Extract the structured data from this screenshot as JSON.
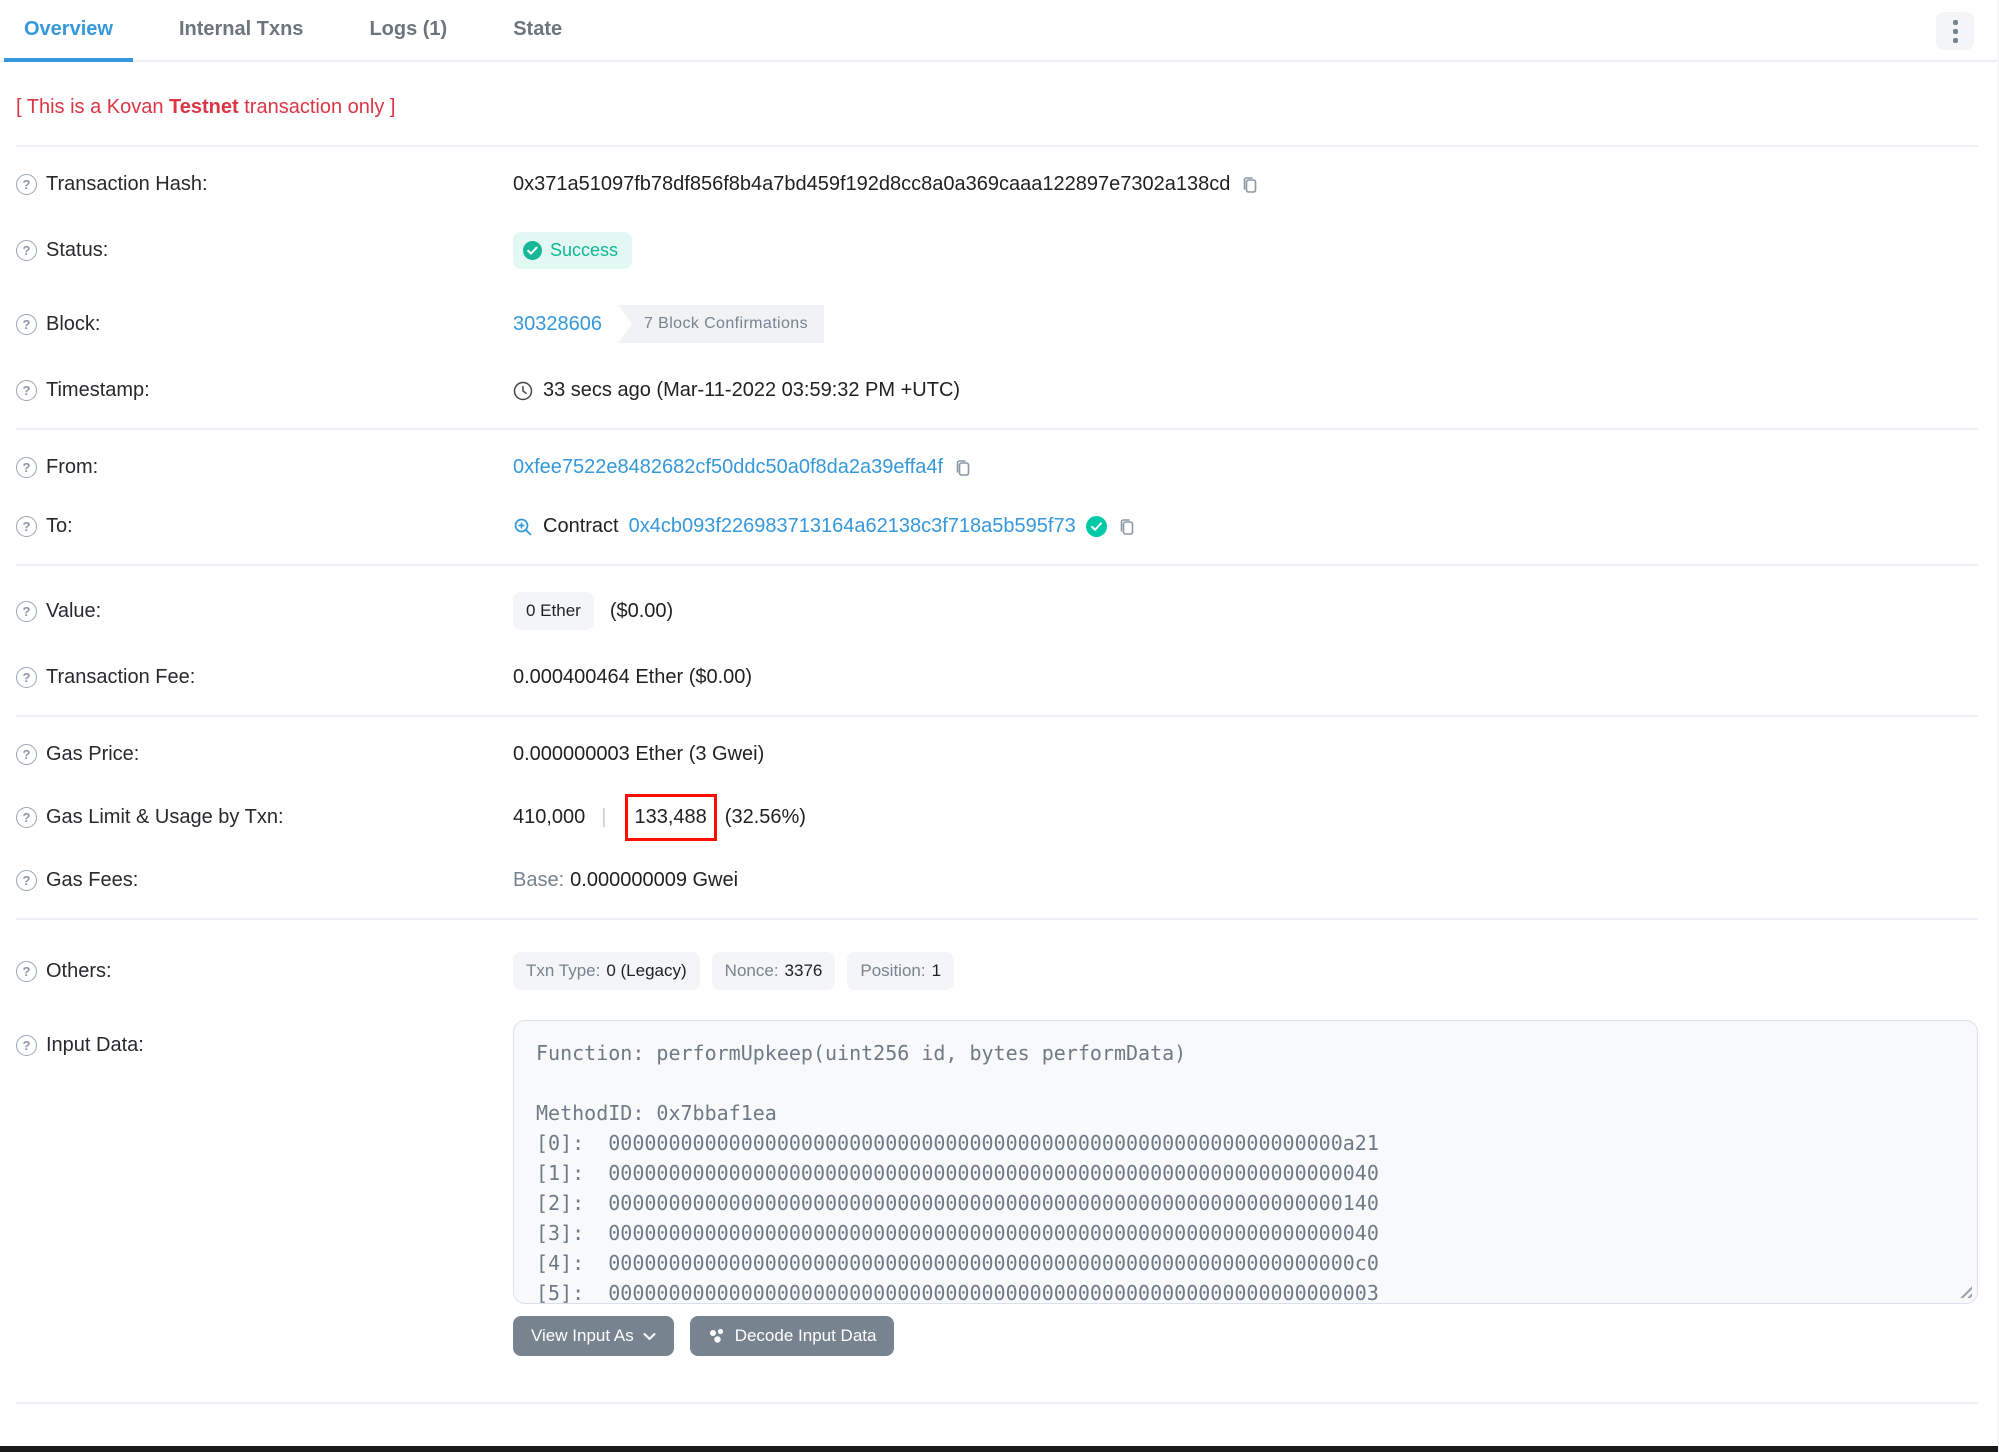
{
  "colors": {
    "accent_blue": "#3498db",
    "success_teal": "#00c9a7",
    "danger_red": "#dc3545",
    "slate": "#77838f"
  },
  "icons": {
    "help": "?"
  },
  "tabs": [
    {
      "label": "Overview",
      "active": true
    },
    {
      "label": "Internal Txns",
      "active": false
    },
    {
      "label": "Logs (1)",
      "active": false
    },
    {
      "label": "State",
      "active": false
    }
  ],
  "banner": {
    "prefix": "[ This is a Kovan ",
    "bold": "Testnet",
    "suffix": " transaction only ]"
  },
  "fields": {
    "tx_hash": {
      "label": "Transaction Hash:",
      "value": "0x371a51097fb78df856f8b4a7bd459f192d8cc8a0a369caaa122897e7302a138cd"
    },
    "status": {
      "label": "Status:",
      "value": "Success"
    },
    "block": {
      "label": "Block:",
      "number": "30328606",
      "confirmations": "7 Block Confirmations"
    },
    "timestamp": {
      "label": "Timestamp:",
      "value": "33 secs ago (Mar-11-2022 03:59:32 PM +UTC)"
    },
    "from": {
      "label": "From:",
      "address": "0xfee7522e8482682cf50ddc50a0f8da2a39effa4f"
    },
    "to": {
      "label": "To:",
      "prefix": "Contract",
      "address": "0x4cb093f226983713164a62138c3f718a5b595f73"
    },
    "value": {
      "label": "Value:",
      "badge": "0 Ether",
      "usd": "($0.00)"
    },
    "tx_fee": {
      "label": "Transaction Fee:",
      "value": "0.000400464 Ether ($0.00)"
    },
    "gas_price": {
      "label": "Gas Price:",
      "value": "0.000000003 Ether (3 Gwei)"
    },
    "gas_limit": {
      "label": "Gas Limit & Usage by Txn:",
      "limit": "410,000",
      "separator": "|",
      "used": "133,488",
      "pct": "(32.56%)"
    },
    "gas_fees": {
      "label": "Gas Fees:",
      "base_label": "Base:",
      "base_value": "0.000000009 Gwei"
    },
    "others": {
      "label": "Others:",
      "badges": [
        {
          "k": "Txn Type:",
          "v": "0 (Legacy)"
        },
        {
          "k": "Nonce:",
          "v": "3376"
        },
        {
          "k": "Position:",
          "v": "1"
        }
      ]
    },
    "input_data": {
      "label": "Input Data:",
      "content": "Function: performUpkeep(uint256 id, bytes performData)\n\nMethodID: 0x7bbaf1ea\n[0]:  0000000000000000000000000000000000000000000000000000000000000a21\n[1]:  0000000000000000000000000000000000000000000000000000000000000040\n[2]:  0000000000000000000000000000000000000000000000000000000000000140\n[3]:  0000000000000000000000000000000000000000000000000000000000000040\n[4]:  00000000000000000000000000000000000000000000000000000000000000c0\n[5]:  0000000000000000000000000000000000000000000000000000000000000003"
    }
  },
  "buttons": {
    "view_input_as": "View Input As",
    "decode_input_data": "Decode Input Data"
  }
}
